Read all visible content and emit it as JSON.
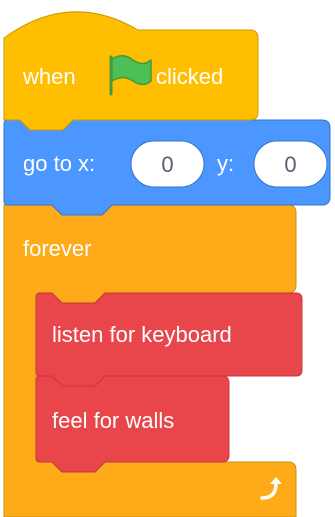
{
  "colors": {
    "events": "#FFBF00",
    "events_border": "#CC9900",
    "motion": "#4C97FF",
    "motion_border": "#3373CC",
    "control": "#FFAB19",
    "control_border": "#CF8B17",
    "custom": "#E8464A",
    "custom_border": "#C73539",
    "flag": "#4CBF56",
    "flag_border": "#45993D",
    "reporter_text": "#575E75"
  },
  "script": {
    "hat_block": {
      "label_before": "when",
      "icon": "green-flag-icon",
      "label_after": "clicked"
    },
    "goto_block": {
      "label": "go to x:",
      "x_value": "0",
      "y_label": "y:",
      "y_value": "0"
    },
    "forever_block": {
      "label": "forever",
      "loop_icon": "loop-arrow-icon",
      "inner_blocks": [
        {
          "label": "listen for keyboard"
        },
        {
          "label": "feel for walls"
        }
      ]
    }
  }
}
